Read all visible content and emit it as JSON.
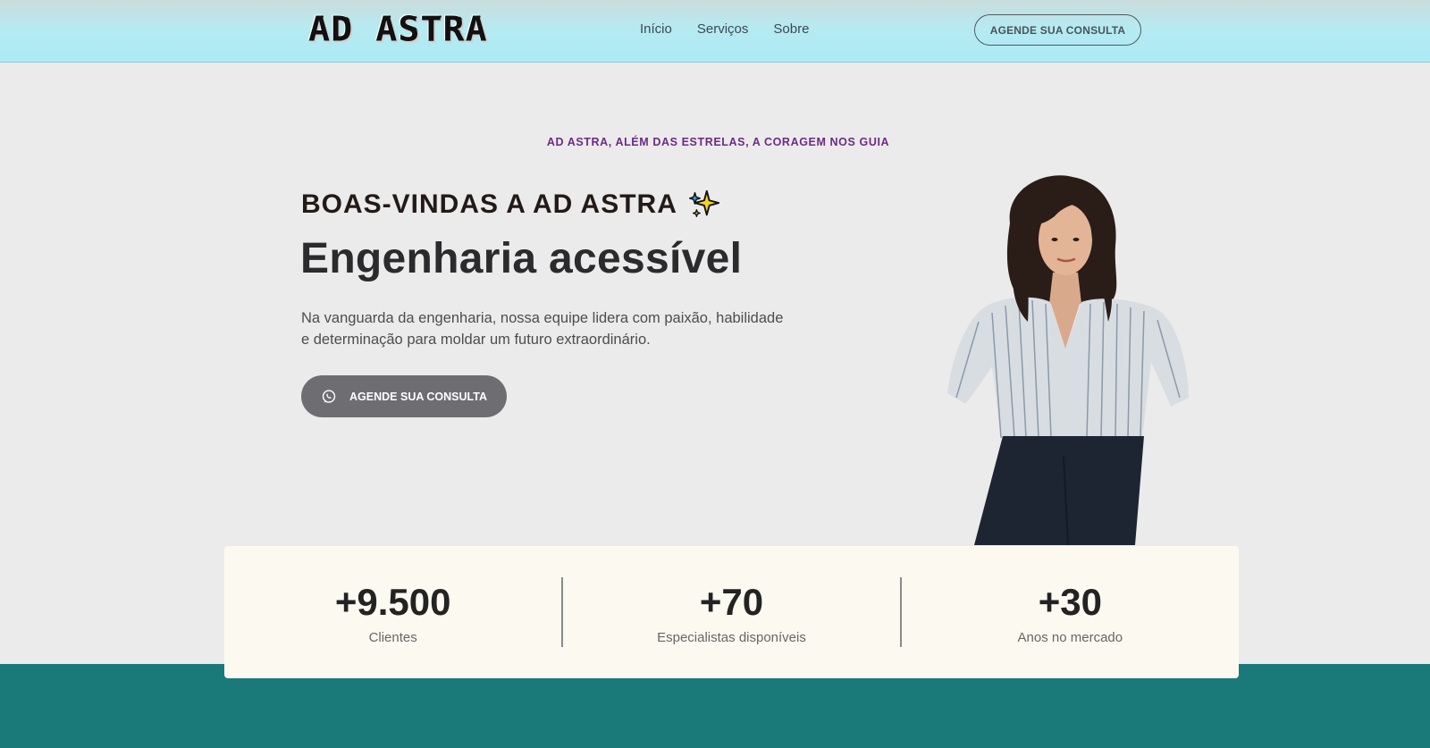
{
  "header": {
    "logo": "AD ASTRA",
    "nav": [
      "Início",
      "Serviços",
      "Sobre"
    ],
    "cta_label": "AGENDE SUA CONSULTA"
  },
  "hero": {
    "tagline": "AD ASTRA, ALÉM DAS ESTRELAS, A CORAGEM NOS GUIA",
    "welcome": "BOAS-VINDAS A AD ASTRA",
    "headline": "Engenharia acessível",
    "description": "Na vanguarda da engenharia, nossa equipe lidera com paixão, habilidade e determinação para moldar um futuro extraordinário.",
    "cta_label": "AGENDE SUA CONSULTA",
    "cta_icon": "whatsapp-icon",
    "welcome_icon": "sparkles-icon"
  },
  "stats": [
    {
      "value": "+9.500",
      "label": "Clientes"
    },
    {
      "value": "+70",
      "label": "Especialistas disponíveis"
    },
    {
      "value": "+30",
      "label": "Anos no mercado"
    }
  ],
  "colors": {
    "accent_purple": "#6d2a86",
    "teal": "#1a7a7a",
    "header_cyan": "#aceaf4",
    "button_gray": "#6e6d72"
  }
}
